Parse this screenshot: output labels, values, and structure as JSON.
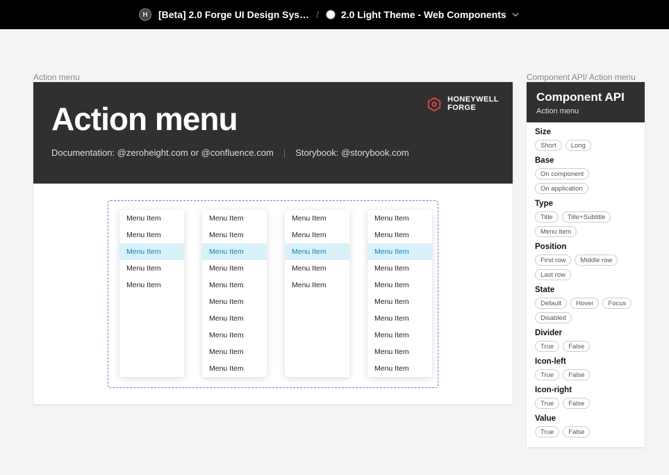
{
  "topbar": {
    "avatar_letter": "H",
    "crumb1": "[Beta] 2.0 Forge UI Design Sys…",
    "crumb2": "2.0 Light Theme - Web Components"
  },
  "labels": {
    "main": "Action menu",
    "side": "Component API/ Action menu"
  },
  "hero": {
    "title": "Action menu",
    "doc_prefix": "Documentation: ",
    "doc_link1": "@zeroheight.com",
    "doc_or": " or ",
    "doc_link2": "@confluence.com",
    "story_prefix": "Storybook: ",
    "story_link": "@storybook.com",
    "brand_line1": "HONEYWELL",
    "brand_line2": "FORGE"
  },
  "menus": [
    {
      "count": 5,
      "selected": 2,
      "item_label": "Menu Item"
    },
    {
      "count": 10,
      "selected": 2,
      "item_label": "Menu Item"
    },
    {
      "count": 5,
      "selected": 2,
      "item_label": "Menu Item"
    },
    {
      "count": 10,
      "selected": 2,
      "item_label": "Menu Item"
    }
  ],
  "sidebar": {
    "title": "Component API",
    "subtitle": "Action menu",
    "props": [
      {
        "name": "Size",
        "options": [
          "Short",
          "Long"
        ]
      },
      {
        "name": "Base",
        "options": [
          "On component",
          "On application"
        ]
      },
      {
        "name": "Type",
        "options": [
          "Title",
          "Title+Subtitle",
          "Menu item"
        ]
      },
      {
        "name": "Position",
        "options": [
          "First row",
          "Middle row",
          "Last row"
        ]
      },
      {
        "name": "State",
        "options": [
          "Default",
          "Hover",
          "Focus",
          "Disabled"
        ]
      },
      {
        "name": "Divider",
        "options": [
          "True",
          "False"
        ]
      },
      {
        "name": "Icon-left",
        "options": [
          "True",
          "False"
        ]
      },
      {
        "name": "Icon-right",
        "options": [
          "True",
          "False"
        ]
      },
      {
        "name": "Value",
        "options": [
          "True",
          "False"
        ]
      }
    ]
  }
}
